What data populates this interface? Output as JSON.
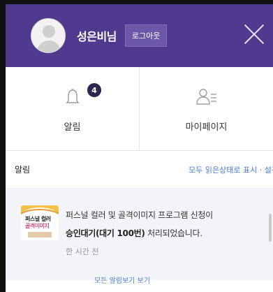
{
  "header": {
    "username": "성은비님",
    "logout_label": "로그아웃",
    "bg_color": "#4f3a8f"
  },
  "tabs": [
    {
      "label": "알림",
      "icon": "bell-icon",
      "badge": "4"
    },
    {
      "label": "마이페이지",
      "icon": "user-list-icon"
    }
  ],
  "alerts": {
    "title": "알림",
    "mark_all_read": "모두 읽은상태로 표시",
    "separator": "·",
    "settings": "설정"
  },
  "notifications": [
    {
      "line1": "퍼스널 컬러 및 골격이미지 프로그램 신청이",
      "status_bold": "승인대기(대기 100번)",
      "status_rest": " 처리되었습니다.",
      "time": "한 시간 전",
      "thumb_icon": "personal-color-thumbnail-icon",
      "thumb_text1": "퍼스널 컬러",
      "thumb_text2": "골격이미지"
    }
  ],
  "bottom_link": "모든 알림보기 보기"
}
